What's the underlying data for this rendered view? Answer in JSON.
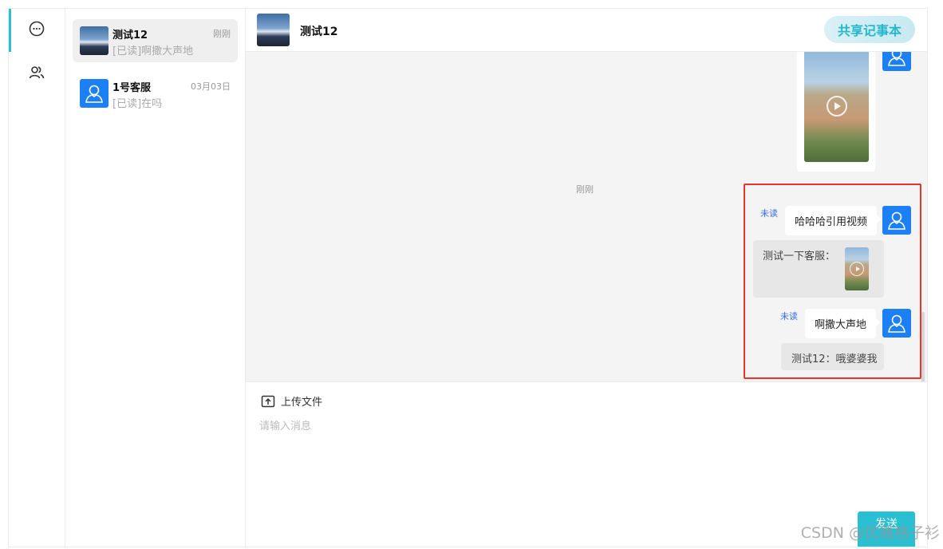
{
  "rail": {
    "items": [
      {
        "icon": "chat-bubble-icon",
        "active": true
      },
      {
        "icon": "contacts-icon",
        "active": false
      }
    ]
  },
  "conversations": [
    {
      "name": "测试12",
      "time": "刚刚",
      "preview": "[已读]啊撒大声地",
      "avatar": "photo",
      "active": true
    },
    {
      "name": "1号客服",
      "time": "03月03日",
      "preview": "[已读]在吗",
      "avatar": "person",
      "active": false
    }
  ],
  "chat": {
    "title": "测试12",
    "notebook_button": "共享记事本",
    "time_separator": "刚刚",
    "messages": [
      {
        "type": "video"
      },
      {
        "type": "text",
        "status": "未读",
        "text": "哈哈哈引用视频"
      },
      {
        "type": "quote",
        "text": "测试一下客服："
      },
      {
        "type": "text",
        "status": "未读",
        "text": "啊撒大声地"
      },
      {
        "type": "quote",
        "text": "测试12：哦婆婆我"
      }
    ]
  },
  "composer": {
    "upload_label": "上传文件",
    "placeholder": "请输入消息",
    "value": "",
    "send_label": "发送"
  },
  "watermark": "CSDN @优雅格子衫",
  "colors": {
    "accent": "#29c0d3",
    "avatar_blue": "#1b7ff5",
    "unread": "#3a6df0",
    "highlight": "#e8342a"
  }
}
